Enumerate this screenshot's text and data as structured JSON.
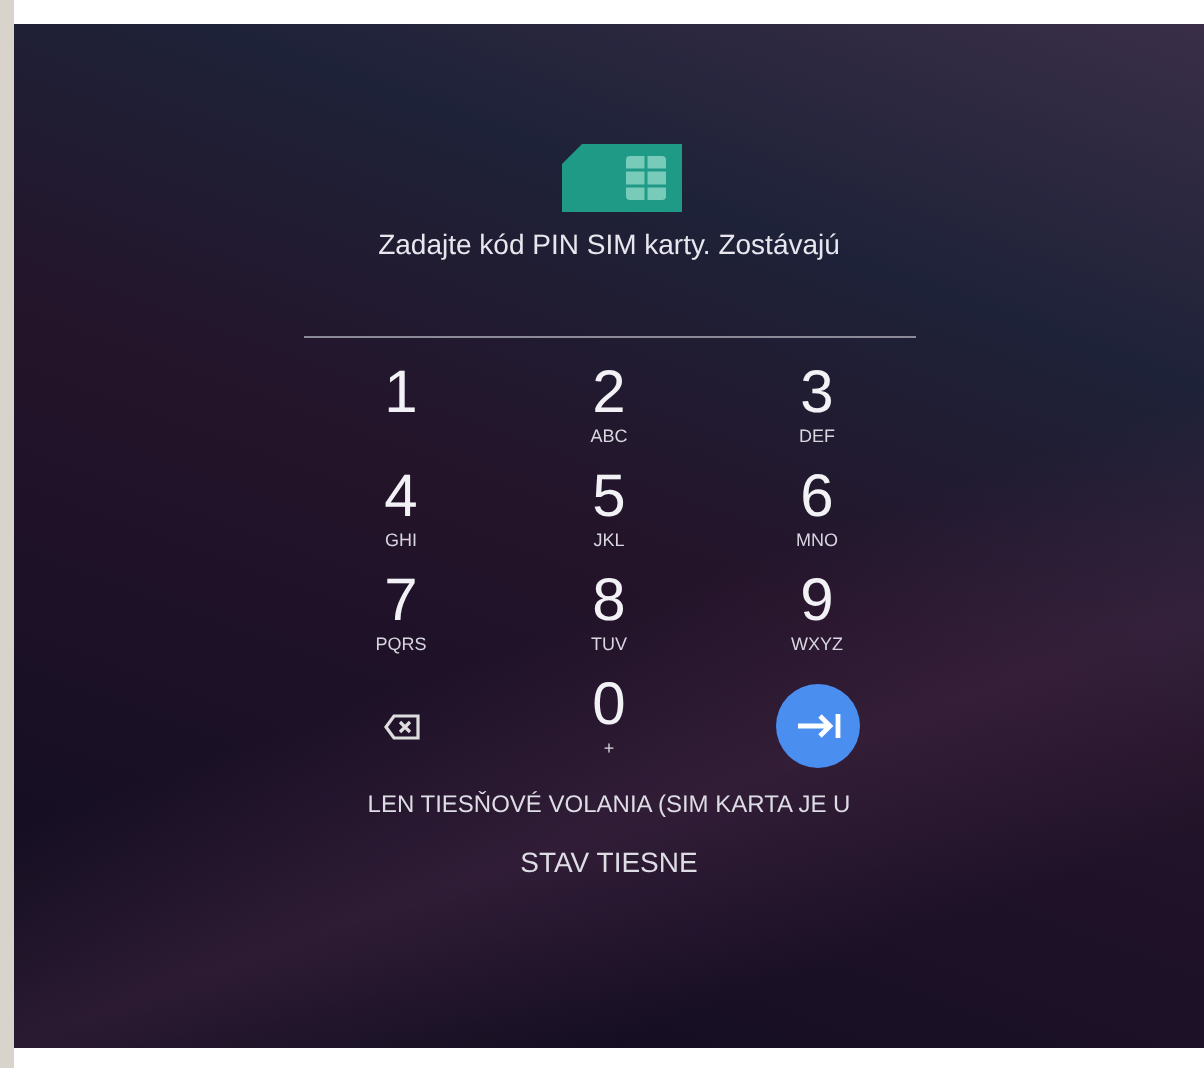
{
  "message": "Zadajte kód PIN SIM karty. Zostávajú",
  "keypad": [
    {
      "kind": "digit",
      "digit": "1"
    },
    {
      "kind": "digit",
      "digit": "2",
      "letters": "ABC"
    },
    {
      "kind": "digit",
      "digit": "3",
      "letters": "DEF"
    },
    {
      "kind": "digit",
      "digit": "4",
      "letters": "GHI"
    },
    {
      "kind": "digit",
      "digit": "5",
      "letters": "JKL"
    },
    {
      "kind": "digit",
      "digit": "6",
      "letters": "MNO"
    },
    {
      "kind": "digit",
      "digit": "7",
      "letters": "PQRS"
    },
    {
      "kind": "digit",
      "digit": "8",
      "letters": "TUV"
    },
    {
      "kind": "digit",
      "digit": "9",
      "letters": "WXYZ"
    },
    {
      "kind": "backspace"
    },
    {
      "kind": "digit",
      "digit": "0",
      "letters": "+"
    },
    {
      "kind": "enter"
    }
  ],
  "emergency_notice": "LEN TIESŇOVÉ VOLANIA (SIM KARTA JE U",
  "emergency_button": "STAV TIESNE"
}
